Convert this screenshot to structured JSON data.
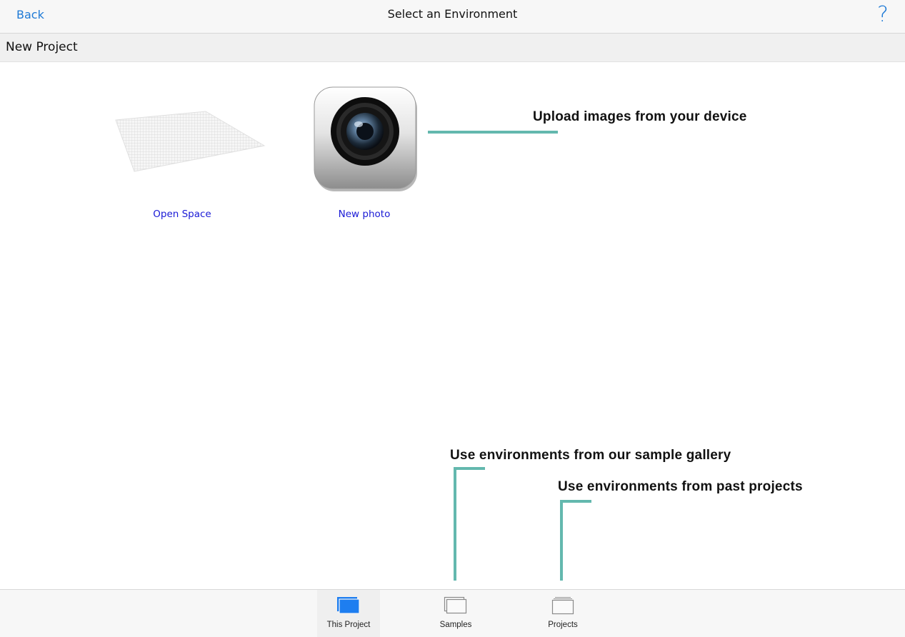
{
  "navbar": {
    "back_label": "Back",
    "title": "Select an Environment",
    "help_label": "?"
  },
  "subheader": {
    "title": "New Project"
  },
  "environments": [
    {
      "label": "Open Space",
      "icon": "open-space-grid-icon"
    },
    {
      "label": "New photo",
      "icon": "camera-icon"
    }
  ],
  "callouts": {
    "upload": "Upload images from your device",
    "samples": "Use environments from our sample gallery",
    "projects": "Use environments from past projects"
  },
  "tabs": [
    {
      "label": "This Project",
      "icon": "this-project-icon",
      "active": true
    },
    {
      "label": "Samples",
      "icon": "samples-icon",
      "active": false
    },
    {
      "label": "Projects",
      "icon": "projects-icon",
      "active": false
    }
  ],
  "colors": {
    "link": "#1e7ad6",
    "item_link": "#1a1ad6",
    "callout_line": "#63b8ae",
    "active_tab": "#1e7ef0"
  }
}
